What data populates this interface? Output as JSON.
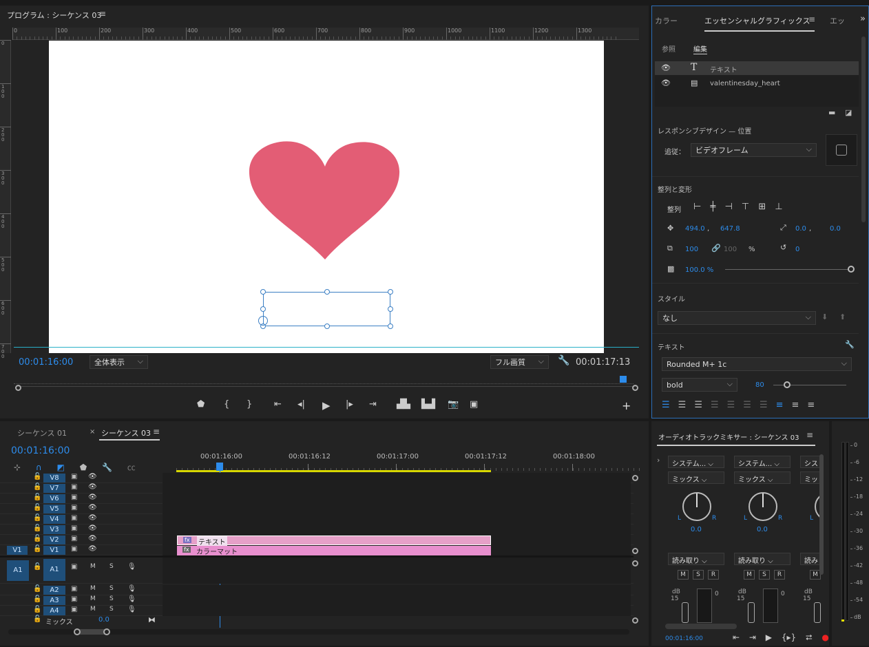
{
  "program": {
    "title": "プログラム : シーケンス 03",
    "timecode_left": "00:01:16:00",
    "timecode_right": "00:01:17:13",
    "zoom": "全体表示",
    "quality": "フル画質",
    "ruler_ticks": [
      "0",
      "100",
      "200",
      "300",
      "400",
      "500",
      "600",
      "700",
      "800",
      "900",
      "1000",
      "1100",
      "1200",
      "1300"
    ],
    "v_ticks": [
      "0",
      "1 0 0",
      "2 0 0",
      "3 0 0",
      "4 0 0",
      "5 0 0",
      "6 0 0",
      "7 0 0"
    ]
  },
  "essential": {
    "tabs": [
      "カラー",
      "エッセンシャルグラフィックス",
      "エッ"
    ],
    "subtabs": [
      "参照",
      "編集"
    ],
    "layers": [
      "テキスト",
      "valentinesday_heart"
    ],
    "responsive_title": "レスポンシブデザイン — 位置",
    "follow_label": "追従：",
    "follow_value": "ビデオフレーム",
    "align_title": "整列と変形",
    "align_label": "整列",
    "pos_x": "494.0",
    "pos_y": "647.8",
    "anchor_x": "0.0",
    "anchor_y": "0.0",
    "scale": "100",
    "scale_h": "100",
    "percent": "%",
    "rotation": "0",
    "opacity": "100.0 %",
    "style_title": "スタイル",
    "style_value": "なし",
    "text_title": "テキスト",
    "font": "Rounded M+ 1c",
    "weight": "bold",
    "size": "80"
  },
  "timeline": {
    "tabs": [
      "シーケンス 01",
      "シーケンス 03"
    ],
    "timecode": "00:01:16:00",
    "ruler": [
      "00:01:16:00",
      "00:01:16:12",
      "00:01:17:00",
      "00:01:17:12",
      "00:01:18:00"
    ],
    "video_tracks": [
      "V8",
      "V7",
      "V6",
      "V5",
      "V4",
      "V3",
      "V2",
      "V1"
    ],
    "audio_tracks": [
      "A1",
      "A2",
      "A3",
      "A4"
    ],
    "src_v": "V1",
    "src_a": "A1",
    "mix_label": "ミックス",
    "mix_value": "0.0",
    "clip_text": "テキスト",
    "clip_matte": "カラーマット",
    "m": "M",
    "s": "S"
  },
  "mixer": {
    "title": "オーディオトラックミキサー : シーケンス 03",
    "channel_names": [
      "システム...",
      "システム...",
      "シス"
    ],
    "mix_labels": [
      "ミックス",
      "ミックス",
      "ミッ"
    ],
    "pan_values": [
      "0.0",
      "0.0"
    ],
    "read_labels": [
      "読み取り",
      "読み取り",
      "読み"
    ],
    "db": "dB",
    "meter_scale": [
      "0",
      "-6",
      "-12",
      "-18",
      "-24",
      "-30",
      "-36",
      "-42",
      "-48",
      "-54",
      "dB"
    ],
    "timecode": "00:01:16:00",
    "l": "L",
    "r": "R",
    "m": "M",
    "s": "S",
    "r_btn": "R",
    "fader_top": "15",
    "fader_0": "0"
  }
}
